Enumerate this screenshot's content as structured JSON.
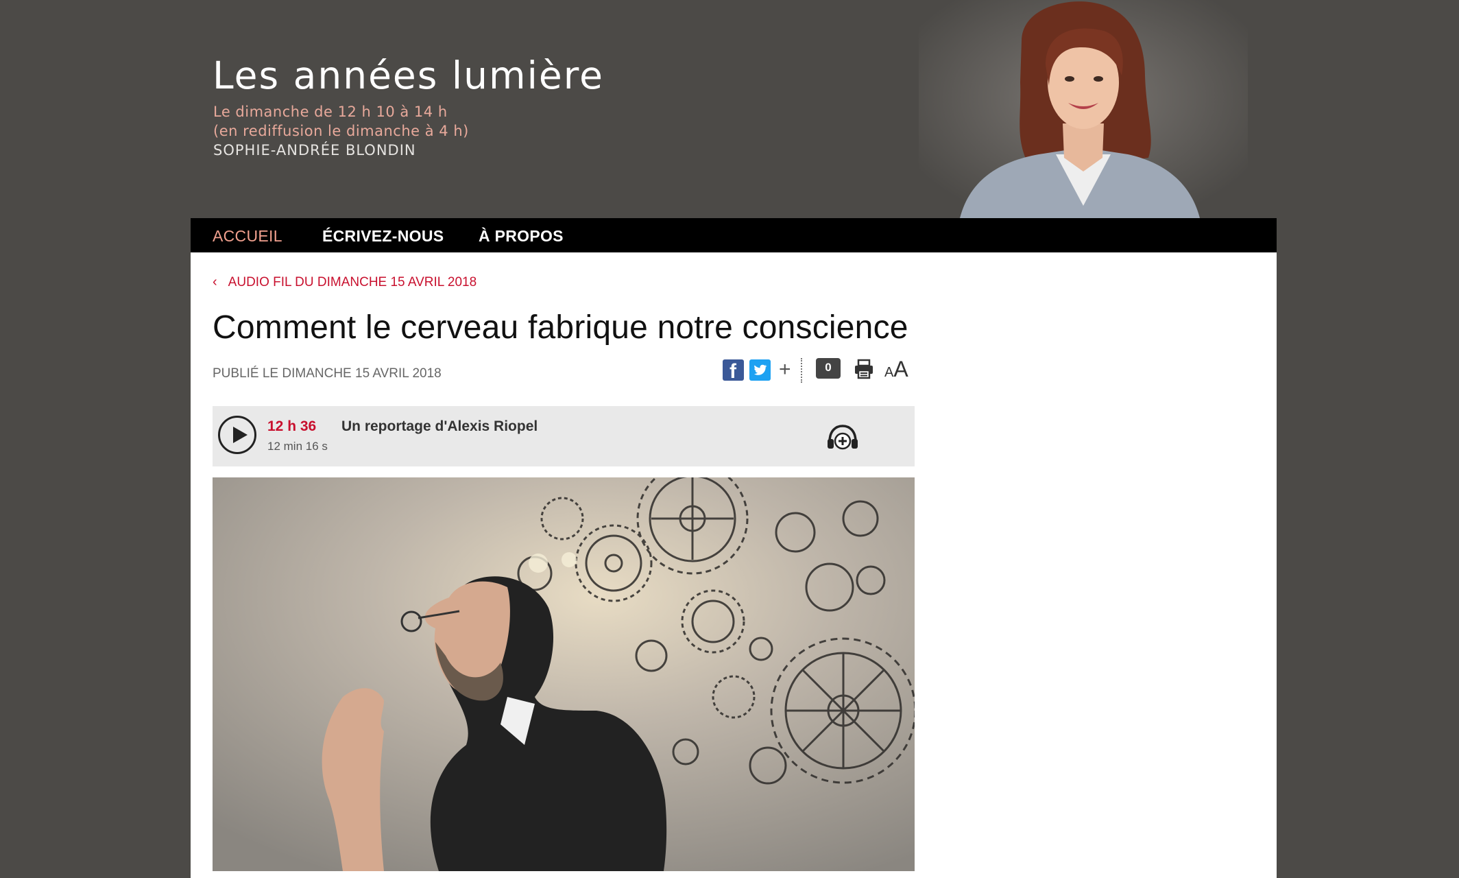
{
  "header": {
    "show_title": "Les années lumière",
    "schedule_line1": "Le dimanche de 12 h 10 à 14 h",
    "schedule_line2": "(en rediffusion le dimanche à 4 h)",
    "host": "SOPHIE-ANDRÉE BLONDIN"
  },
  "nav": {
    "items": [
      {
        "label": "ACCUEIL",
        "active": true
      },
      {
        "label": "ÉCRIVEZ-NOUS",
        "active": false
      },
      {
        "label": "À PROPOS",
        "active": false
      }
    ]
  },
  "article": {
    "breadcrumb": "AUDIO FIL DU DIMANCHE 15 AVRIL 2018",
    "title": "Comment le cerveau fabrique notre conscience",
    "published": "PUBLIÉ LE DIMANCHE 15 AVRIL 2018",
    "comment_count": "0",
    "font_size_small": "A",
    "font_size_big": "A"
  },
  "audio": {
    "time": "12 h 36",
    "label": "Un reportage d'Alexis Riopel",
    "duration": "12 min 16 s"
  },
  "icons": {
    "facebook": "facebook-icon",
    "twitter": "twitter-icon",
    "more": "plus-icon",
    "comments": "comment-icon",
    "print": "print-icon",
    "font": "font-size-icon",
    "play": "play-icon",
    "playlist": "headphones-plus-icon"
  },
  "colors": {
    "background": "#4c4a47",
    "accent_red": "#c8102e",
    "nav_active": "#f0a08e",
    "schedule": "#e8a99b",
    "navbar": "#000000"
  }
}
